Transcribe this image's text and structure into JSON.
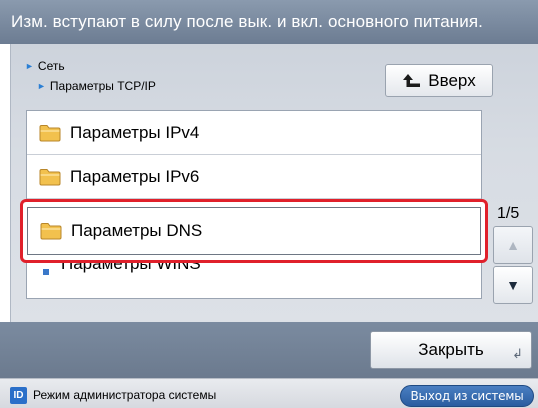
{
  "notice": {
    "text": "Изм. вступают в силу после вык. и вкл. основного питания."
  },
  "breadcrumb": {
    "level1": "Сеть",
    "level2": "Параметры TCP/IP"
  },
  "toolbar": {
    "up_label": "Вверх"
  },
  "list": {
    "items": [
      {
        "label": "Параметры IPv4"
      },
      {
        "label": "Параметры IPv6"
      },
      {
        "label": "Параметры DNS",
        "selected": true
      },
      {
        "label": "Параметры WINS"
      }
    ]
  },
  "pager": {
    "indicator": "1/5"
  },
  "footer": {
    "close_label": "Закрыть"
  },
  "status": {
    "id_badge": "ID",
    "admin_mode": "Режим администратора системы",
    "logout_label": "Выход из системы"
  },
  "colors": {
    "highlight": "#e0202b",
    "accent": "#2a6fc9"
  }
}
